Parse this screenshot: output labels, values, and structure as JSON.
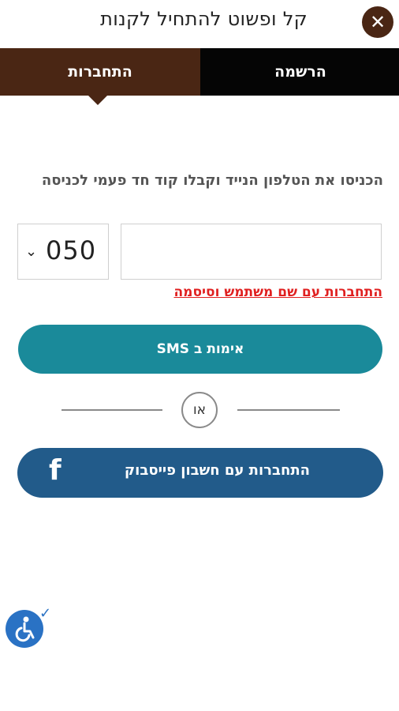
{
  "header": {
    "title": "קל ופשוט להתחיל לקנות",
    "close_icon": "✕"
  },
  "tabs": {
    "register_label": "הרשמה",
    "login_label": "התחברות",
    "active": "login"
  },
  "login_form": {
    "instruction": "הכניסו את הטלפון הנייד וקבלו קוד חד פעמי לכניסה",
    "phone_value": "",
    "prefix_value": "050",
    "user_pass_link": "התחברות עם שם משתמש וסיסמה",
    "sms_button": "אימות ב SMS",
    "or_label": "או",
    "facebook_button": "התחברות עם חשבון פייסבוק"
  },
  "icons": {
    "close": "close-icon",
    "facebook": "facebook-icon",
    "accessibility": "accessibility-icon",
    "check": "check-icon",
    "chevron": "chevron-down-icon"
  },
  "colors": {
    "brand_brown": "#4a2614",
    "register_tab": "#050505",
    "sms_teal": "#1a8a9a",
    "facebook_blue": "#225b8a",
    "link_red": "#e02020",
    "a11y_blue": "#2a72c4"
  }
}
